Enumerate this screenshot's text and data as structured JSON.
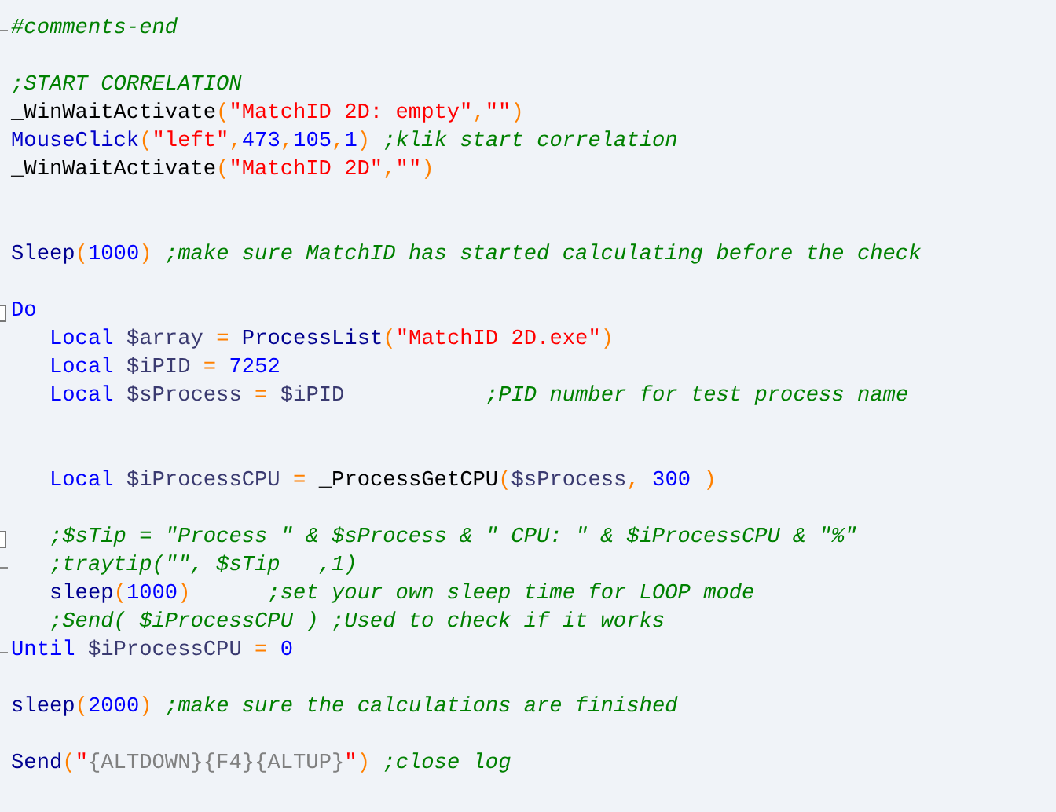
{
  "lines": [
    {
      "kind": "fold-end",
      "tokens": [
        {
          "kind": "comment",
          "text": "#comments-end"
        }
      ]
    },
    {
      "kind": "blank"
    },
    {
      "kind": "code",
      "tokens": [
        {
          "kind": "comment",
          "text": ";START CORRELATION"
        }
      ]
    },
    {
      "kind": "code",
      "tokens": [
        {
          "kind": "udf",
          "text": "_WinWaitActivate"
        },
        {
          "kind": "operator",
          "text": "("
        },
        {
          "kind": "string",
          "text": "\"MatchID 2D: empty\""
        },
        {
          "kind": "operator",
          "text": ","
        },
        {
          "kind": "string",
          "text": "\"\""
        },
        {
          "kind": "operator",
          "text": ")"
        }
      ]
    },
    {
      "kind": "code",
      "tokens": [
        {
          "kind": "builtin",
          "text": "MouseClick"
        },
        {
          "kind": "operator",
          "text": "("
        },
        {
          "kind": "string",
          "text": "\"left\""
        },
        {
          "kind": "operator",
          "text": ","
        },
        {
          "kind": "number",
          "text": "473"
        },
        {
          "kind": "operator",
          "text": ","
        },
        {
          "kind": "number",
          "text": "105"
        },
        {
          "kind": "operator",
          "text": ","
        },
        {
          "kind": "number",
          "text": "1"
        },
        {
          "kind": "operator",
          "text": ")"
        },
        {
          "kind": "comment",
          "text": " ;klik start correlation"
        }
      ]
    },
    {
      "kind": "code",
      "tokens": [
        {
          "kind": "udf",
          "text": "_WinWaitActivate"
        },
        {
          "kind": "operator",
          "text": "("
        },
        {
          "kind": "string",
          "text": "\"MatchID 2D\""
        },
        {
          "kind": "operator",
          "text": ","
        },
        {
          "kind": "string",
          "text": "\"\""
        },
        {
          "kind": "operator",
          "text": ")"
        }
      ]
    },
    {
      "kind": "blank"
    },
    {
      "kind": "blank"
    },
    {
      "kind": "code",
      "tokens": [
        {
          "kind": "function",
          "text": "Sleep"
        },
        {
          "kind": "operator",
          "text": "("
        },
        {
          "kind": "number",
          "text": "1000"
        },
        {
          "kind": "operator",
          "text": ")"
        },
        {
          "kind": "comment",
          "text": " ;make sure MatchID has started calculating before the check"
        }
      ]
    },
    {
      "kind": "blank"
    },
    {
      "kind": "fold-start",
      "tokens": [
        {
          "kind": "keyword",
          "text": "Do"
        }
      ]
    },
    {
      "kind": "code",
      "tokens": [
        {
          "kind": "keyword",
          "text": "   Local"
        },
        {
          "kind": "variable",
          "text": " $array"
        },
        {
          "kind": "operator",
          "text": " ="
        },
        {
          "kind": "function",
          "text": " ProcessList"
        },
        {
          "kind": "operator",
          "text": "("
        },
        {
          "kind": "string",
          "text": "\"MatchID 2D.exe\""
        },
        {
          "kind": "operator",
          "text": ")"
        }
      ]
    },
    {
      "kind": "code",
      "tokens": [
        {
          "kind": "keyword",
          "text": "   Local"
        },
        {
          "kind": "variable",
          "text": " $iPID"
        },
        {
          "kind": "operator",
          "text": " ="
        },
        {
          "kind": "number",
          "text": " 7252"
        }
      ]
    },
    {
      "kind": "code",
      "tokens": [
        {
          "kind": "keyword",
          "text": "   Local"
        },
        {
          "kind": "variable",
          "text": " $sProcess"
        },
        {
          "kind": "operator",
          "text": " ="
        },
        {
          "kind": "variable",
          "text": " $iPID"
        },
        {
          "kind": "comment",
          "text": "           ;PID number for test process name"
        }
      ]
    },
    {
      "kind": "blank"
    },
    {
      "kind": "blank"
    },
    {
      "kind": "code",
      "tokens": [
        {
          "kind": "keyword",
          "text": "   Local"
        },
        {
          "kind": "variable",
          "text": " $iProcessCPU"
        },
        {
          "kind": "operator",
          "text": " ="
        },
        {
          "kind": "udf",
          "text": " _ProcessGetCPU"
        },
        {
          "kind": "operator",
          "text": "("
        },
        {
          "kind": "variable",
          "text": "$sProcess"
        },
        {
          "kind": "operator",
          "text": ","
        },
        {
          "kind": "number",
          "text": " 300"
        },
        {
          "kind": "operator",
          "text": " )"
        }
      ]
    },
    {
      "kind": "blank"
    },
    {
      "kind": "fold-start",
      "tokens": [
        {
          "kind": "comment",
          "text": "   ;$sTip = \"Process \" & $sProcess & \" CPU: \" & $iProcessCPU & \"%\""
        }
      ]
    },
    {
      "kind": "fold-end",
      "tokens": [
        {
          "kind": "comment",
          "text": "   ;traytip(\"\", $sTip   ,1)"
        }
      ]
    },
    {
      "kind": "code",
      "tokens": [
        {
          "kind": "function",
          "text": "   sleep"
        },
        {
          "kind": "operator",
          "text": "("
        },
        {
          "kind": "number",
          "text": "1000"
        },
        {
          "kind": "operator",
          "text": ")"
        },
        {
          "kind": "comment",
          "text": "      ;set your own sleep time for LOOP mode"
        }
      ]
    },
    {
      "kind": "code",
      "tokens": [
        {
          "kind": "comment",
          "text": "   ;Send( $iProcessCPU ) ;Used to check if it works"
        }
      ]
    },
    {
      "kind": "fold-end",
      "tokens": [
        {
          "kind": "keyword",
          "text": "Until"
        },
        {
          "kind": "variable",
          "text": " $iProcessCPU"
        },
        {
          "kind": "operator",
          "text": " ="
        },
        {
          "kind": "number",
          "text": " 0"
        }
      ]
    },
    {
      "kind": "blank"
    },
    {
      "kind": "code",
      "tokens": [
        {
          "kind": "function",
          "text": "sleep"
        },
        {
          "kind": "operator",
          "text": "("
        },
        {
          "kind": "number",
          "text": "2000"
        },
        {
          "kind": "operator",
          "text": ")"
        },
        {
          "kind": "comment",
          "text": " ;make sure the calculations are finished"
        }
      ]
    },
    {
      "kind": "blank"
    },
    {
      "kind": "code",
      "tokens": [
        {
          "kind": "function",
          "text": "Send"
        },
        {
          "kind": "operator",
          "text": "("
        },
        {
          "kind": "string",
          "text": "\""
        },
        {
          "kind": "sendkey",
          "text": "{ALTDOWN}{F4}{ALTUP}"
        },
        {
          "kind": "string",
          "text": "\""
        },
        {
          "kind": "operator",
          "text": ")"
        },
        {
          "kind": "comment",
          "text": " ;close log"
        }
      ]
    }
  ]
}
